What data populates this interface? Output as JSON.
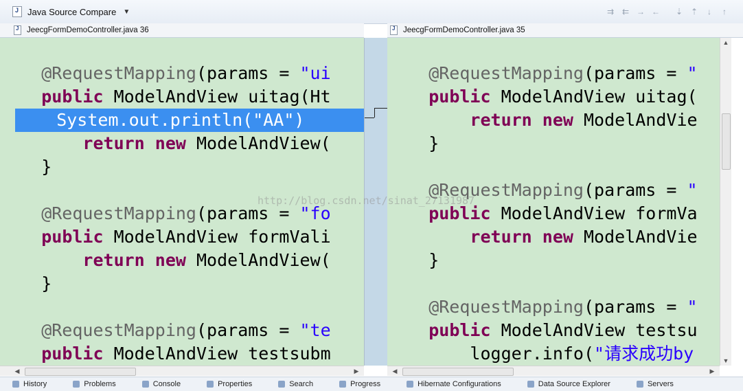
{
  "toolbar": {
    "compare_title": "Java Source Compare",
    "icons": [
      "copy-all-left-icon",
      "copy-all-right-icon",
      "copy-left-icon",
      "copy-right-icon",
      "next-diff-icon",
      "prev-diff-icon",
      "next-change-icon",
      "prev-change-icon"
    ]
  },
  "left_pane": {
    "filename": "JeecgFormDemoController.java 36",
    "lines": [
      "",
      "    @RequestMapping(params = \"ui",
      "    public ModelAndView uitag(Ht",
      "        System.out.println(\"AA\")",
      "        return new ModelAndView(",
      "    }",
      "",
      "    @RequestMapping(params = \"fo",
      "    public ModelAndView formVali",
      "        return new ModelAndView(",
      "    }",
      "",
      "    @RequestMapping(params = \"te",
      "    public ModelAndView testsubm"
    ]
  },
  "right_pane": {
    "filename": "JeecgFormDemoController.java 35",
    "lines": [
      "",
      "    @RequestMapping(params = \"",
      "    public ModelAndView uitag(",
      "        return new ModelAndVie",
      "    }",
      "",
      "    @RequestMapping(params = \"",
      "    public ModelAndView formVa",
      "        return new ModelAndVie",
      "    }",
      "",
      "    @RequestMapping(params = \"",
      "    public ModelAndView testsu",
      "        logger.info(\"请求成功by"
    ]
  },
  "watermark": "http://blog.csdn.net/sinat_27131987",
  "bottom_tabs": [
    "History",
    "Problems",
    "Console",
    "Properties",
    "Search",
    "Progress",
    "Hibernate Configurations",
    "Data Source Explorer",
    "Servers"
  ]
}
